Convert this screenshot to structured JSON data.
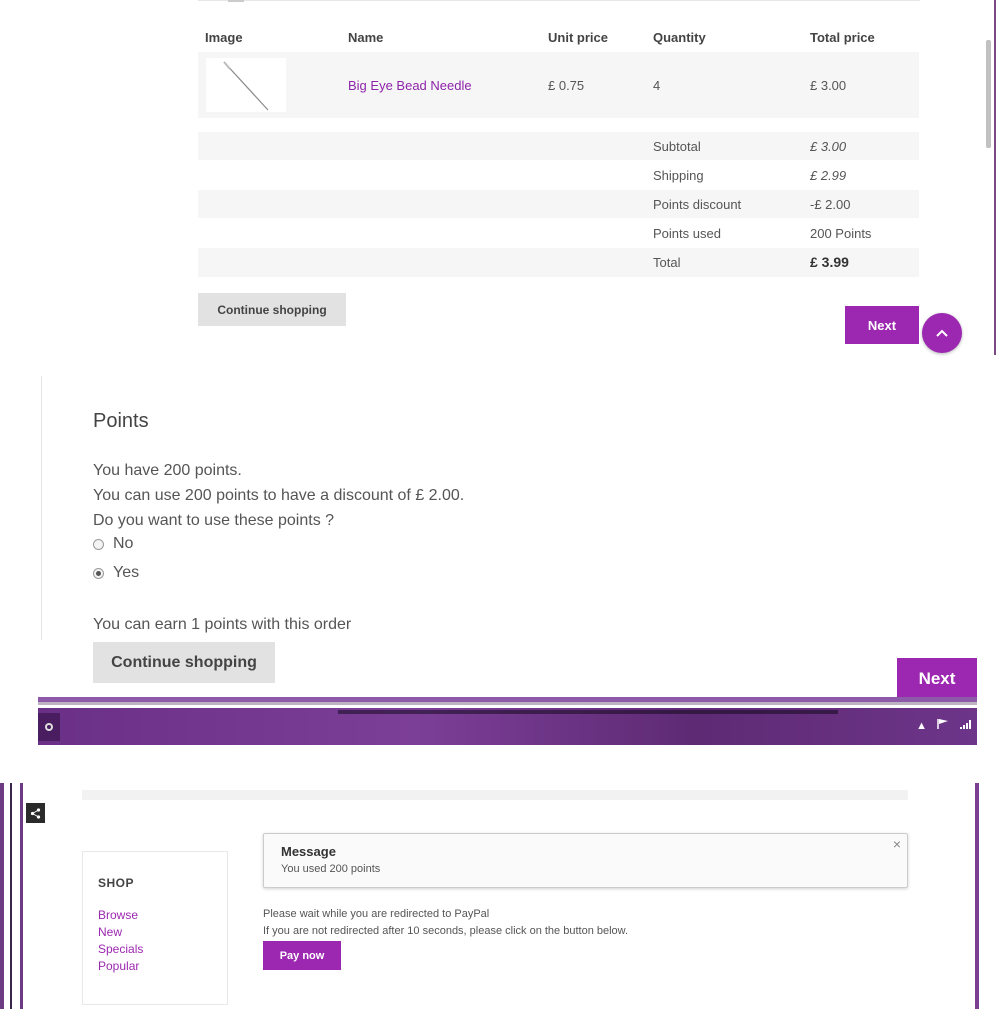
{
  "cart": {
    "headers": {
      "image": "Image",
      "name": "Name",
      "unit_price": "Unit price",
      "quantity": "Quantity",
      "total_price": "Total price"
    },
    "item": {
      "name": "Big Eye Bead Needle",
      "unit_price": "£ 0.75",
      "quantity": "4",
      "total_price": "£ 3.00"
    },
    "summary": [
      {
        "label": "Subtotal",
        "value": "£ 3.00"
      },
      {
        "label": "Shipping",
        "value": "£ 2.99"
      },
      {
        "label": "Points discount",
        "value": "-£ 2.00"
      },
      {
        "label": "Points used",
        "value": "200 Points"
      },
      {
        "label": "Total",
        "value": "£ 3.99"
      }
    ],
    "continue_label": "Continue shopping",
    "next_label": "Next"
  },
  "points": {
    "title": "Points",
    "line1": "You have 200 points.",
    "line2": "You can use 200 points to have a discount of £ 2.00.",
    "line3": "Do you want to use these points ?",
    "options": [
      {
        "label": "No",
        "selected": false
      },
      {
        "label": "Yes",
        "selected": true
      }
    ],
    "earn_text": "You can earn 1 points with this order",
    "continue_label": "Continue shopping",
    "next_label": "Next"
  },
  "message": {
    "title": "Message",
    "text": "You used 200 points",
    "close_glyph": "×",
    "redirect_line1": "Please wait while you are redirected to PayPal",
    "redirect_line2": "If you are not redirected after 10 seconds, please click on the button below.",
    "pay_label": "Pay now"
  },
  "shop": {
    "title": "SHOP",
    "links": [
      "Browse",
      "New",
      "Specials",
      "Popular"
    ]
  },
  "colors": {
    "accent": "#9c27b0",
    "taskbar": "#6a2f86"
  }
}
